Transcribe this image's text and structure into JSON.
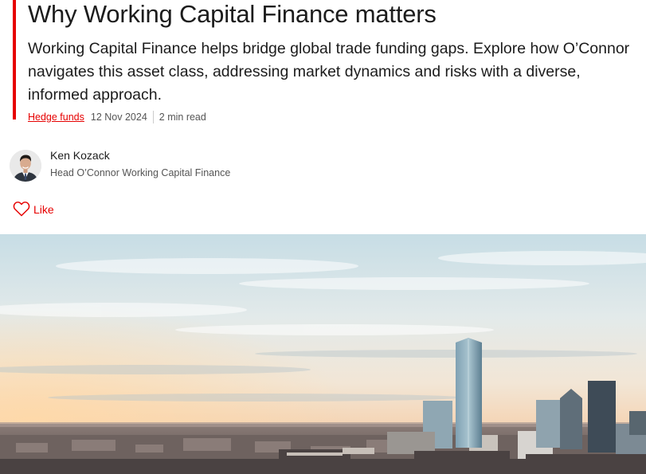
{
  "article": {
    "title": "Why Working Capital Finance matters",
    "lead": "Working Capital Finance helps bridge global trade funding gaps. Explore how O’Connor navigates this asset class, addressing market dynamics and risks with a diverse, informed approach.",
    "category": "Hedge funds",
    "date": "12 Nov 2024",
    "read_time": "2 min read"
  },
  "author": {
    "name": "Ken Kozack",
    "role": "Head O’Connor Working Capital Finance"
  },
  "like": {
    "label": "Like",
    "icon": "heart-outline-icon"
  },
  "hero": {
    "image": "city-skyline-photo"
  },
  "colors": {
    "accent": "#e60000",
    "text": "#1c1c1c",
    "muted": "#555555"
  }
}
